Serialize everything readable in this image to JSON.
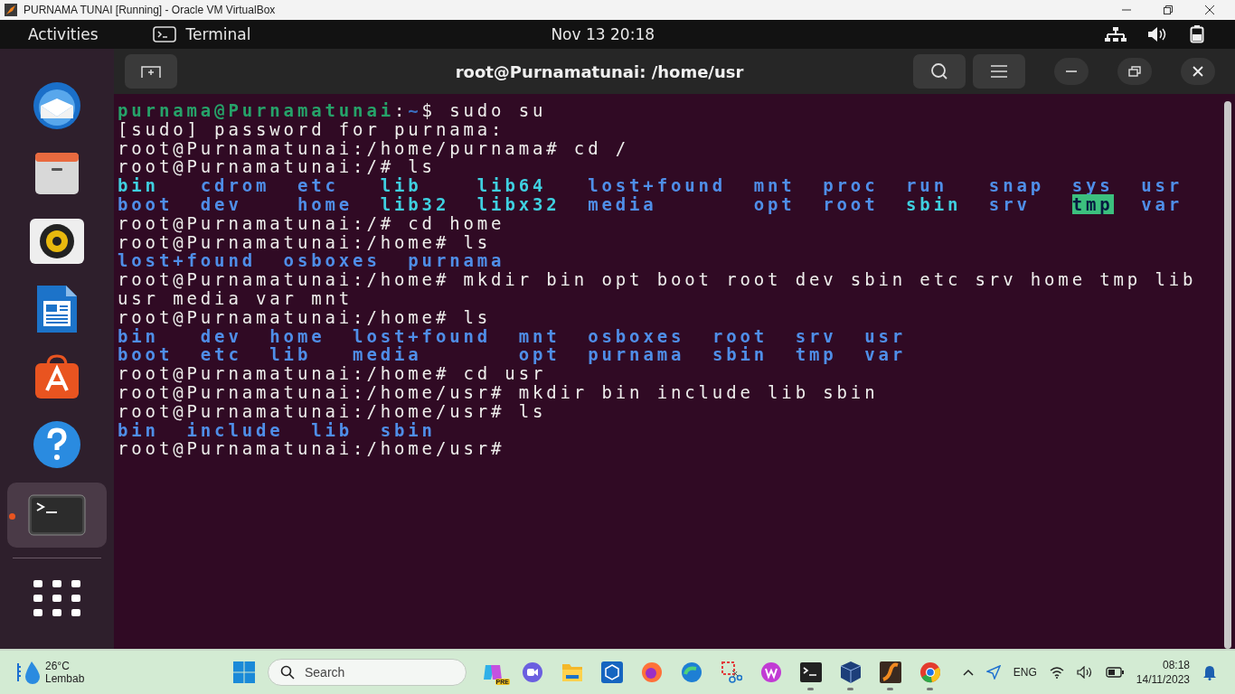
{
  "vbox_window": {
    "title": "PURNAMA TUNAI [Running] - Oracle VM VirtualBox"
  },
  "top_bar": {
    "activities": "Activities",
    "app": "Terminal",
    "clock": "Nov 13  20:18"
  },
  "dock": {
    "items": [
      {
        "kind": "mail",
        "running": false
      },
      {
        "kind": "files",
        "running": false
      },
      {
        "kind": "music",
        "running": false
      },
      {
        "kind": "writer",
        "running": false
      },
      {
        "kind": "store",
        "running": false
      },
      {
        "kind": "help",
        "running": false
      },
      {
        "kind": "terminal",
        "running": true
      },
      {
        "kind": "apps",
        "running": false
      }
    ]
  },
  "terminal": {
    "title": "root@Purnamatunai: /home/usr",
    "lines": [
      {
        "kind": "text",
        "segments": [
          {
            "text": "purnama@Purnamatunai",
            "kind": "user"
          },
          {
            "text": ":",
            "kind": "plain"
          },
          {
            "text": "~",
            "kind": "path"
          },
          {
            "text": "$ sudo su",
            "kind": "plain"
          }
        ]
      },
      {
        "kind": "text",
        "segments": [
          {
            "text": "[sudo] password for purnama:",
            "kind": "plain"
          }
        ]
      },
      {
        "kind": "text",
        "segments": [
          {
            "text": "root@Purnamatunai:/home/purnama# cd /",
            "kind": "plain"
          }
        ]
      },
      {
        "kind": "text",
        "segments": [
          {
            "text": "root@Purnamatunai:/# ls",
            "kind": "plain"
          }
        ]
      },
      {
        "kind": "ls",
        "rows": [
          [
            {
              "name": "bin",
              "kind": "link"
            },
            {
              "name": "cdrom",
              "kind": "dir"
            },
            {
              "name": "etc",
              "kind": "dir"
            },
            {
              "name": "lib",
              "kind": "link"
            },
            {
              "name": "lib64",
              "kind": "link"
            },
            {
              "name": "lost+found",
              "kind": "dir"
            },
            {
              "name": "mnt",
              "kind": "dir"
            },
            {
              "name": "proc",
              "kind": "dir"
            },
            {
              "name": "run",
              "kind": "dir"
            },
            {
              "name": "snap",
              "kind": "dir"
            },
            {
              "name": "sys",
              "kind": "dir"
            },
            {
              "name": "usr",
              "kind": "dir"
            }
          ],
          [
            {
              "name": "boot",
              "kind": "dir"
            },
            {
              "name": "dev",
              "kind": "dir"
            },
            {
              "name": "home",
              "kind": "dir"
            },
            {
              "name": "lib32",
              "kind": "link"
            },
            {
              "name": "libx32",
              "kind": "link"
            },
            {
              "name": "media",
              "kind": "dir"
            },
            {
              "name": "opt",
              "kind": "dir"
            },
            {
              "name": "root",
              "kind": "dir"
            },
            {
              "name": "sbin",
              "kind": "link"
            },
            {
              "name": "srv",
              "kind": "dir"
            },
            {
              "name": "tmp",
              "kind": "sticky"
            },
            {
              "name": "var",
              "kind": "dir"
            }
          ]
        ]
      },
      {
        "kind": "text",
        "segments": [
          {
            "text": "root@Purnamatunai:/# cd home",
            "kind": "plain"
          }
        ]
      },
      {
        "kind": "text",
        "segments": [
          {
            "text": "root@Purnamatunai:/home# ls",
            "kind": "plain"
          }
        ]
      },
      {
        "kind": "ls",
        "rows": [
          [
            {
              "name": "lost+found",
              "kind": "dir"
            },
            {
              "name": "osboxes",
              "kind": "dir"
            },
            {
              "name": "purnama",
              "kind": "dir"
            }
          ]
        ]
      },
      {
        "kind": "text",
        "segments": [
          {
            "text": "root@Purnamatunai:/home# mkdir bin opt boot root dev sbin etc srv home tmp lib usr media var mnt",
            "kind": "plain"
          }
        ]
      },
      {
        "kind": "text",
        "segments": [
          {
            "text": "root@Purnamatunai:/home# ls",
            "kind": "plain"
          }
        ]
      },
      {
        "kind": "ls",
        "rows": [
          [
            {
              "name": "bin",
              "kind": "dir"
            },
            {
              "name": "dev",
              "kind": "dir"
            },
            {
              "name": "home",
              "kind": "dir"
            },
            {
              "name": "lost+found",
              "kind": "dir"
            },
            {
              "name": "mnt",
              "kind": "dir"
            },
            {
              "name": "osboxes",
              "kind": "dir"
            },
            {
              "name": "root",
              "kind": "dir"
            },
            {
              "name": "srv",
              "kind": "dir"
            },
            {
              "name": "usr",
              "kind": "dir"
            }
          ],
          [
            {
              "name": "boot",
              "kind": "dir"
            },
            {
              "name": "etc",
              "kind": "dir"
            },
            {
              "name": "lib",
              "kind": "dir"
            },
            {
              "name": "media",
              "kind": "dir"
            },
            {
              "name": "opt",
              "kind": "dir"
            },
            {
              "name": "purnama",
              "kind": "dir"
            },
            {
              "name": "sbin",
              "kind": "dir"
            },
            {
              "name": "tmp",
              "kind": "dir"
            },
            {
              "name": "var",
              "kind": "dir"
            }
          ]
        ]
      },
      {
        "kind": "text",
        "segments": [
          {
            "text": "root@Purnamatunai:/home# cd usr",
            "kind": "plain"
          }
        ]
      },
      {
        "kind": "text",
        "segments": [
          {
            "text": "root@Purnamatunai:/home/usr# mkdir bin include lib sbin",
            "kind": "plain"
          }
        ]
      },
      {
        "kind": "text",
        "segments": [
          {
            "text": "root@Purnamatunai:/home/usr# ls",
            "kind": "plain"
          }
        ]
      },
      {
        "kind": "ls",
        "rows": [
          [
            {
              "name": "bin",
              "kind": "dir"
            },
            {
              "name": "include",
              "kind": "dir"
            },
            {
              "name": "lib",
              "kind": "dir"
            },
            {
              "name": "sbin",
              "kind": "dir"
            }
          ]
        ]
      },
      {
        "kind": "text",
        "segments": [
          {
            "text": "root@Purnamatunai:/home/usr#",
            "kind": "plain"
          }
        ]
      }
    ]
  },
  "taskbar": {
    "weather": {
      "temperature": "26°C",
      "condition": "Lembab"
    },
    "search": {
      "placeholder": "Search"
    },
    "apps": [
      {
        "kind": "copilot",
        "badge": "PRE",
        "running": false
      },
      {
        "kind": "meet",
        "running": false
      },
      {
        "kind": "folder",
        "running": false
      },
      {
        "kind": "cube",
        "running": false
      },
      {
        "kind": "firefox",
        "running": false
      },
      {
        "kind": "edge",
        "running": false
      },
      {
        "kind": "snip",
        "running": false
      },
      {
        "kind": "wps",
        "running": false
      },
      {
        "kind": "terminal",
        "running": true
      },
      {
        "kind": "vbox",
        "running": true
      },
      {
        "kind": "orange",
        "running": true
      },
      {
        "kind": "chrome",
        "running": true
      }
    ],
    "language": "ENG",
    "time": "08:18",
    "date": "14/11/2023"
  }
}
